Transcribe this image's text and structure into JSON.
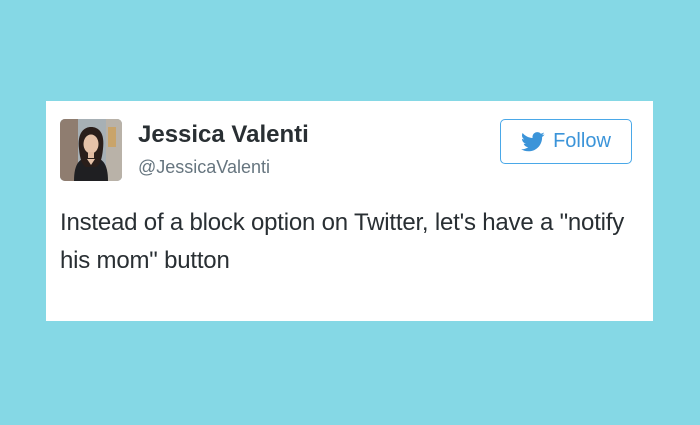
{
  "tweet": {
    "author_name": "Jessica Valenti",
    "author_handle": "@JessicaValenti",
    "follow_label": "Follow",
    "text": "Instead of a block option on Twitter, let's have a \"notify his mom\" button"
  },
  "colors": {
    "background": "#85d8e5",
    "card": "#ffffff",
    "accent": "#3b94d9",
    "name_text": "#292f33",
    "handle_text": "#66757f"
  },
  "icons": {
    "follow_icon": "twitter-bird-icon"
  }
}
